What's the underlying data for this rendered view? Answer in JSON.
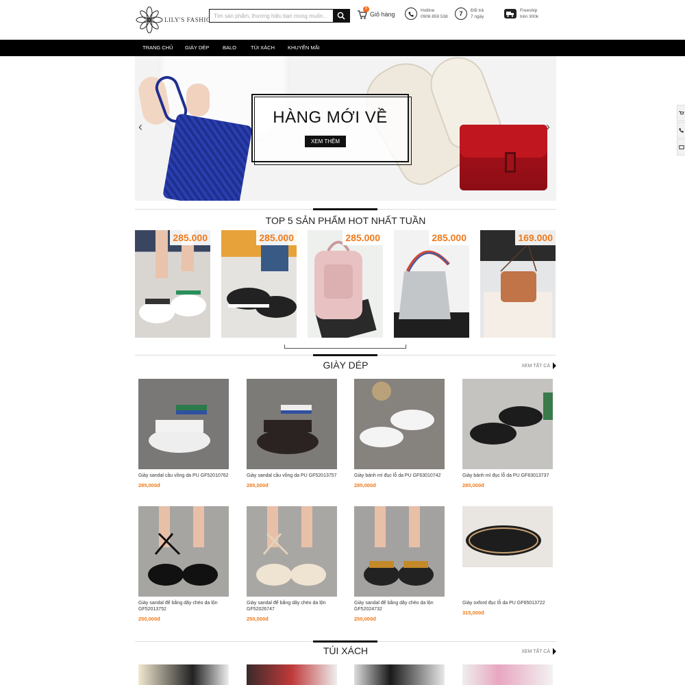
{
  "header": {
    "logo_text": "LILY'S FASHION",
    "search_placeholder": "Tìm sản phẩm, thương hiệu bạn mong muốn...",
    "cart_count": "0",
    "cart_label": "Giỏ hàng",
    "hotline_label": "Hotline",
    "hotline_number": "0906 859 538",
    "return_label": "Đổi trả",
    "return_days": "7 ngày",
    "return_number": "7",
    "ship_label": "Freeship",
    "ship_condition": "trên 300k"
  },
  "nav": {
    "items": [
      "TRANG CHỦ",
      "GIÀY DÉP",
      "BALO",
      "TÚI XÁCH",
      "KHUYẾN MÃI"
    ]
  },
  "banner": {
    "title": "HÀNG MỚI VỀ",
    "button": "XEM THÊM",
    "prev": "‹",
    "next": "›"
  },
  "top5": {
    "title": "TOP 5 SẢN PHẨM HOT NHẤT TUẦN",
    "items": [
      {
        "price": "285.000"
      },
      {
        "price": "285.000"
      },
      {
        "price": "285.000"
      },
      {
        "price": "285.000"
      },
      {
        "price": "169.000"
      }
    ]
  },
  "shoes": {
    "title": "GIÀY DÉP",
    "see_all": "XEM TẤT CẢ",
    "products": [
      {
        "name": "Giày sandal cầu vồng da PU GF52010762",
        "price": "285,000đ"
      },
      {
        "name": "Giày sandal cầu vồng da PU GF52013757",
        "price": "285,000đ"
      },
      {
        "name": "Giày bánh mì đục lỗ da PU GF63010742",
        "price": "285,000đ"
      },
      {
        "name": "Giày bánh mì đục lỗ da PU GF63013737",
        "price": "285,000đ"
      },
      {
        "name": "Giày sandal đế bằng dây chéo da lộn GF52013752",
        "price": "250,000đ"
      },
      {
        "name": "Giày sandal đế bằng dây chéo da lộn GF52026747",
        "price": "250,000đ"
      },
      {
        "name": "Giày sandal đế bằng dây chéo da lộn GF52024732",
        "price": "250,000đ"
      },
      {
        "name": "Giày oxford đục lỗ da PU GF65013722",
        "price": "315,000đ"
      }
    ]
  },
  "bags": {
    "title": "TÚI XÁCH",
    "see_all": "XEM TẤT CẢ"
  },
  "colors": {
    "accent": "#f07a1b",
    "nav_bg": "#000000",
    "badge": "#f26b21"
  }
}
